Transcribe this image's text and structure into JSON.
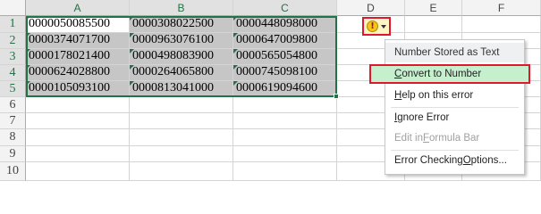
{
  "columns": [
    "A",
    "B",
    "C",
    "D",
    "E",
    "F"
  ],
  "rows": [
    "1",
    "2",
    "3",
    "4",
    "5",
    "6",
    "7",
    "8",
    "9",
    "10"
  ],
  "cells": [
    [
      "000005008550​0",
      "0000308022500",
      "0000448098000"
    ],
    [
      "0000374071700",
      "0000963076100",
      "0000647009800"
    ],
    [
      "0000178021400",
      "0000498083900",
      "0000565054800"
    ],
    [
      "0000624028800",
      "0000264065800",
      "0000745098100"
    ],
    [
      "0000105093100",
      "0000813041000",
      "0000619094600"
    ]
  ],
  "error_button": {
    "icon": "warning-icon",
    "symbol": "!"
  },
  "menu": {
    "header": "Number Stored as Text",
    "convert": {
      "pre": "",
      "u": "C",
      "post": "onvert to Number"
    },
    "help": {
      "pre": "",
      "u": "H",
      "post": "elp on this error"
    },
    "ignore": {
      "pre": "",
      "u": "I",
      "post": "gnore Error"
    },
    "edit": {
      "pre": "Edit in ",
      "u": "F",
      "post": "ormula Bar"
    },
    "options": {
      "pre": "Error Checking ",
      "u": "O",
      "post": "ptions..."
    }
  },
  "colors": {
    "accent": "#217346",
    "highlight_border": "#e0182d",
    "highlight_bg": "#c6efce"
  }
}
